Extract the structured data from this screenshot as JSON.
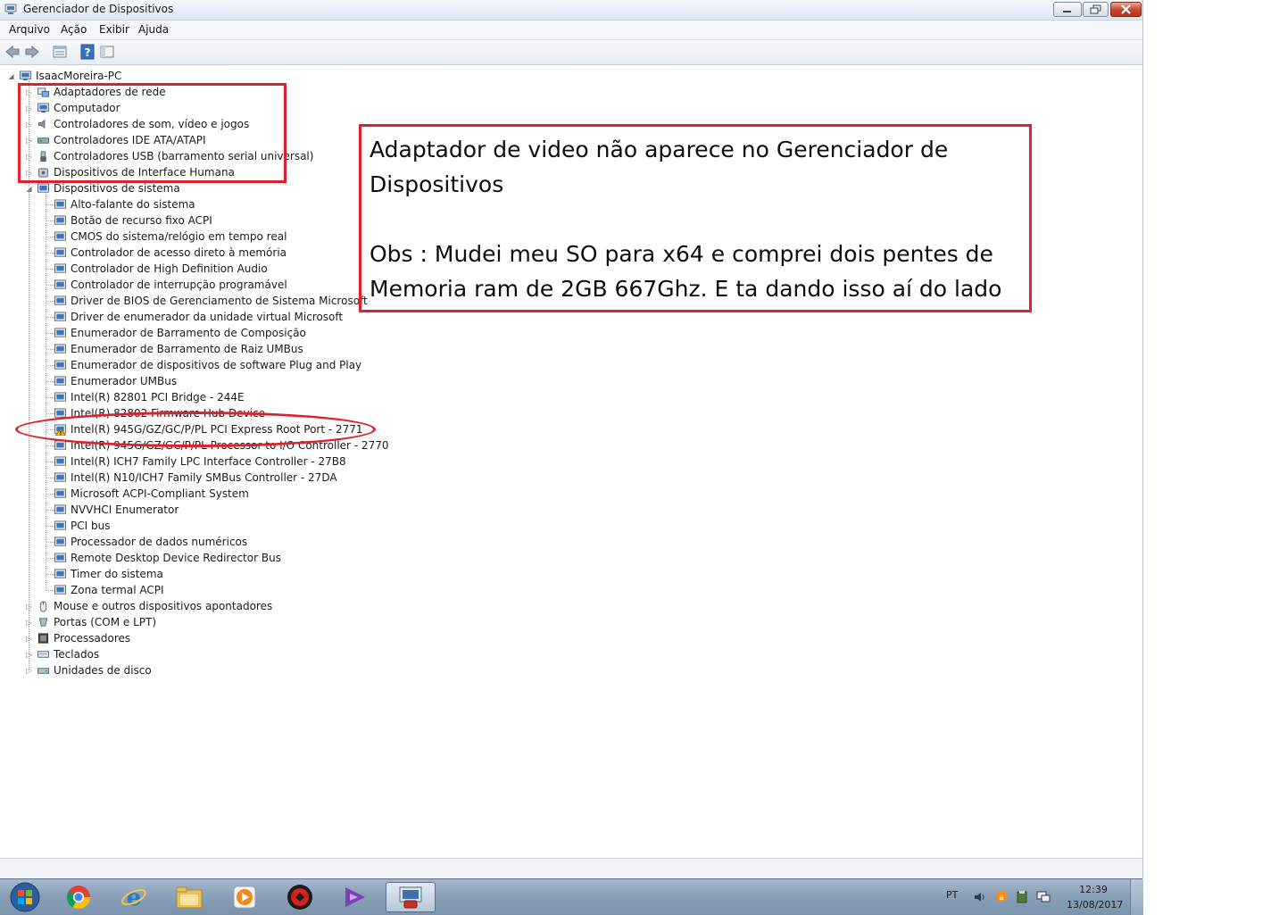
{
  "window": {
    "title": "Gerenciador de Dispositivos"
  },
  "menu": [
    "Arquivo",
    "Ação",
    "Exibir",
    "Ajuda"
  ],
  "toolbar_icons": [
    "back-arrow-icon",
    "forward-arrow-icon",
    "properties-view-icon",
    "help-icon",
    "properties-pane-icon"
  ],
  "tree": {
    "root": "IsaacMoreira-PC",
    "categories_top": [
      {
        "label": "Adaptadores de rede",
        "icon": "network-adapter-icon"
      },
      {
        "label": "Computador",
        "icon": "computer-icon"
      },
      {
        "label": "Controladores de som, vídeo e jogos",
        "icon": "speaker-icon"
      },
      {
        "label": "Controladores IDE ATA/ATAPI",
        "icon": "ide-controller-icon"
      },
      {
        "label": "Controladores USB (barramento serial universal)",
        "icon": "usb-icon"
      },
      {
        "label": "Dispositivos de Interface Humana",
        "icon": "hid-icon"
      }
    ],
    "expanded": {
      "label": "Dispositivos de sistema",
      "children": [
        "Alto-falante do sistema",
        "Botão de recurso fixo ACPI",
        "CMOS do sistema/relógio em tempo real",
        "Controlador de acesso direto à memória",
        "Controlador de High Definition Audio",
        "Controlador de interrupção programável",
        "Driver de BIOS de Gerenciamento de Sistema Microsoft",
        "Driver de enumerador da unidade virtual Microsoft",
        "Enumerador de Barramento de Composição",
        "Enumerador de Barramento de Raiz UMBus",
        "Enumerador de dispositivos de software Plug and Play",
        "Enumerador UMBus",
        "Intel(R) 82801 PCI Bridge - 244E",
        "Intel(R) 82802 Firmware Hub Device",
        "Intel(R) 945G/GZ/GC/P/PL PCI Express Root Port - 2771",
        "Intel(R) 945G/GZ/GC/P/PL Processor to I/O Controller - 2770",
        "Intel(R) ICH7 Family LPC Interface Controller - 27B8",
        "Intel(R) N10/ICH7 Family SMBus Controller - 27DA",
        "Microsoft ACPI-Compliant System",
        "NVVHCI Enumerator",
        "PCI bus",
        "Processador de dados numéricos",
        "Remote Desktop Device Redirector Bus",
        "Timer do sistema",
        "Zona termal ACPI"
      ],
      "warning_child_index": 14
    },
    "categories_bottom": [
      {
        "label": "Mouse e outros dispositivos apontadores",
        "icon": "mouse-icon"
      },
      {
        "label": "Portas (COM e LPT)",
        "icon": "port-icon"
      },
      {
        "label": "Processadores",
        "icon": "processor-icon"
      },
      {
        "label": "Teclados",
        "icon": "keyboard-icon"
      },
      {
        "label": "Unidades de disco",
        "icon": "disk-drive-icon"
      }
    ]
  },
  "annotation": {
    "line1": "Adaptador de video não aparece no Gerenciador de Dispositivos",
    "line2": "Obs : Mudei meu SO para x64 e comprei dois pentes de Memoria ram de 2GB 667Ghz. E ta dando isso aí do lado",
    "color": "#e0202a"
  },
  "taskbar": {
    "apps": [
      "start-orb-icon",
      "chrome-icon",
      "internet-explorer-icon",
      "file-explorer-icon",
      "media-player-icon",
      "red-app-icon",
      "visual-studio-icon",
      "device-manager-icon"
    ],
    "language": "PT",
    "time": "12:39",
    "date": "13/08/2017"
  }
}
